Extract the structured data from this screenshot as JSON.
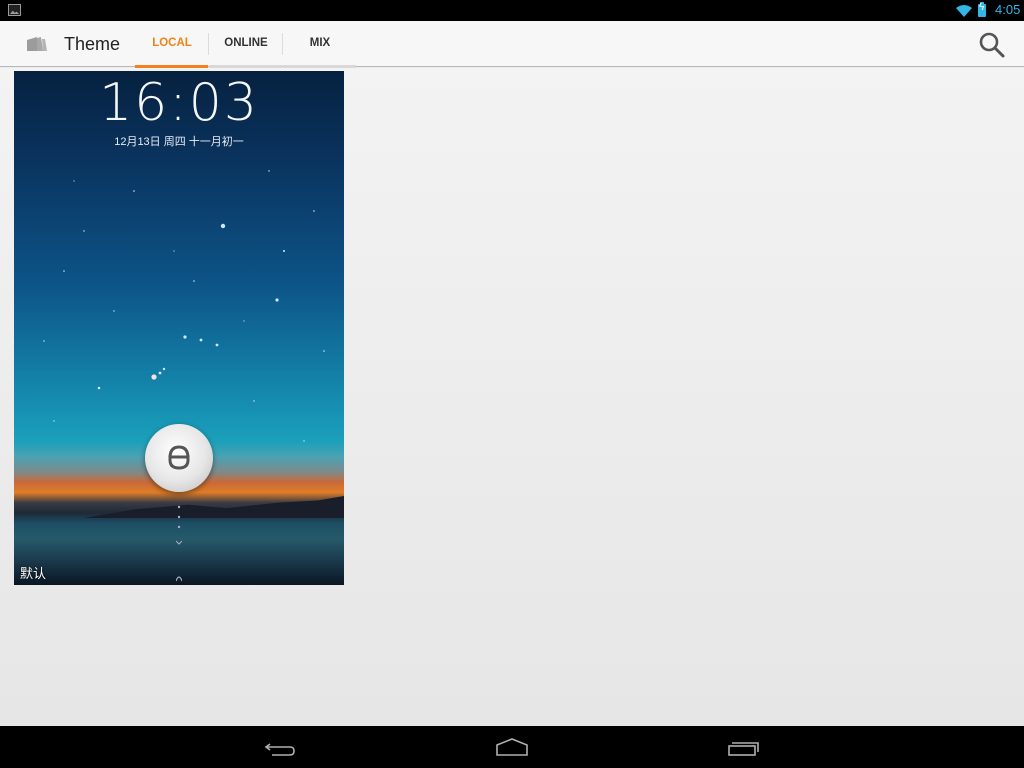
{
  "status_bar": {
    "time": "4:05",
    "icons": [
      "image-notification-icon",
      "wifi-icon",
      "battery-charging-icon"
    ]
  },
  "action_bar": {
    "title": "Theme",
    "app_icon": "theme-folder-icon",
    "tabs": [
      {
        "label": "LOCAL",
        "active": true
      },
      {
        "label": "ONLINE",
        "active": false
      },
      {
        "label": "MIX",
        "active": false
      }
    ],
    "search_icon": "search-icon"
  },
  "colors": {
    "accent": "#f58220",
    "status_accent": "#33b5e5",
    "action_bar_bg": "#f7f7f7",
    "content_bg": "#ececec"
  },
  "themes": [
    {
      "name": "默认",
      "preview": {
        "time": "16:03",
        "date": "12月13日 周四  十一月初一",
        "unlock_icon": "lock-icon"
      }
    }
  ],
  "nav_bar": {
    "buttons": [
      "back-icon",
      "home-icon",
      "recent-apps-icon"
    ]
  }
}
